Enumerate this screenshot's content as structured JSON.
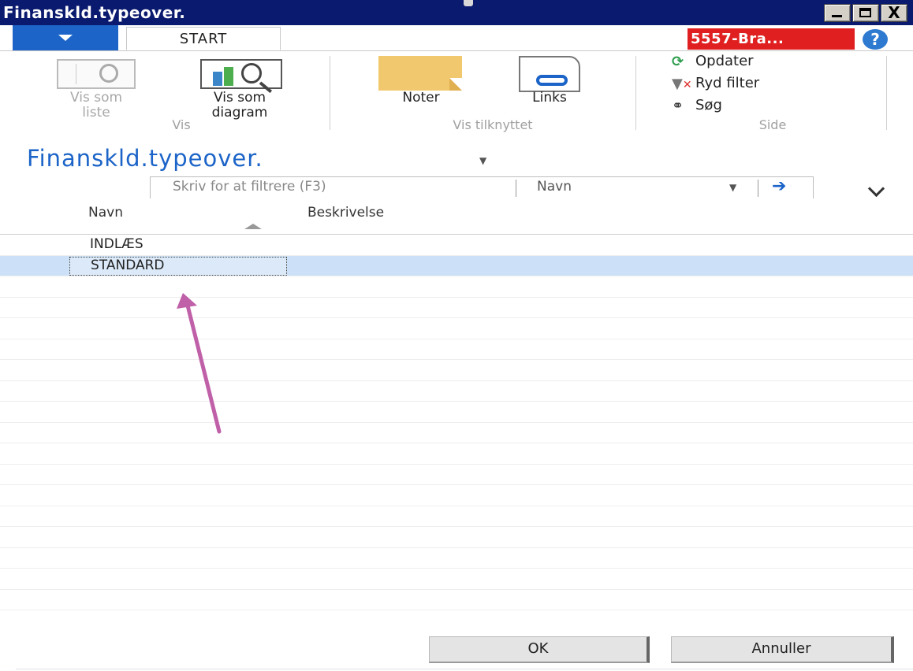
{
  "window": {
    "title": "Finanskld.typeover.",
    "controls": {
      "minimize": "_",
      "maximize": "□",
      "close": "X"
    }
  },
  "ribbon": {
    "tabs": [
      {
        "label": "START"
      }
    ],
    "company": "5557-Bra...",
    "help": "?",
    "groups": {
      "vis": {
        "label": "Vis",
        "vis_som_liste": [
          "Vis som",
          "liste"
        ],
        "vis_som_diagram": [
          "Vis som",
          "diagram"
        ]
      },
      "vis_tilknyttet": {
        "label": "Vis tilknyttet",
        "noter": "Noter",
        "links": "Links"
      },
      "side": {
        "label": "Side",
        "opdater": "Opdater",
        "ryd_filter": "Ryd filter",
        "soeg": "Søg"
      }
    }
  },
  "page": {
    "title": "Finanskld.typeover.",
    "filter": {
      "placeholder": "Skriv for at filtrere (F3)",
      "field": "Navn"
    }
  },
  "grid": {
    "columns": [
      "Navn",
      "Beskrivelse"
    ],
    "rows": [
      {
        "navn": "INDLÆS",
        "beskrivelse": ""
      },
      {
        "navn": "STANDARD",
        "beskrivelse": ""
      }
    ]
  },
  "buttons": {
    "ok": "OK",
    "cancel": "Annuller"
  },
  "colors": {
    "title_bar": "#0a1a6e",
    "accent_blue": "#1c64c8",
    "company_badge": "#e02020",
    "selected_row": "#cce1f7",
    "annotation_arrow": "#c060a8"
  }
}
